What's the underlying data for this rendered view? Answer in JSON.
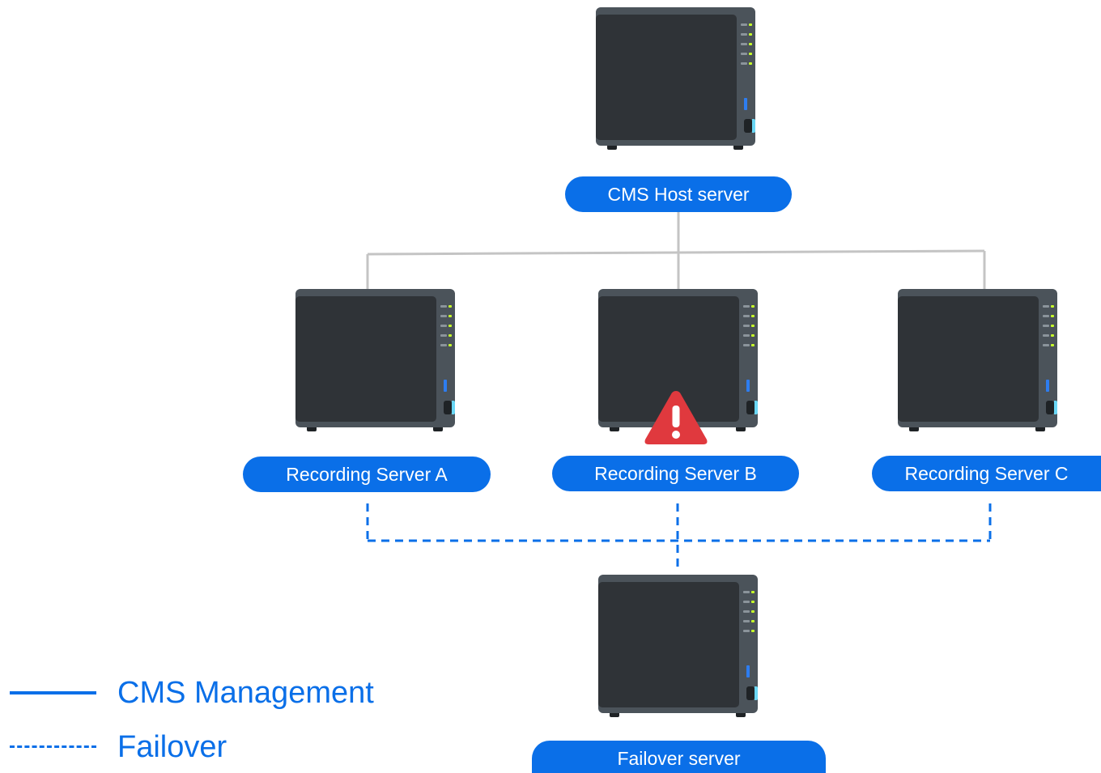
{
  "nodes": {
    "cms_host": {
      "label": "CMS Host server"
    },
    "recording_a": {
      "label": "Recording Server A"
    },
    "recording_b": {
      "label": "Recording Server B",
      "status": "warning"
    },
    "recording_c": {
      "label": "Recording Server C"
    },
    "failover": {
      "label": "Failover server"
    }
  },
  "legend": {
    "management": {
      "label": "CMS Management",
      "style": "solid"
    },
    "failover": {
      "label": "Failover",
      "style": "dashed"
    }
  },
  "colors": {
    "accent": "#0a6fe8",
    "management_connector": "#c4c4c4",
    "warning": "#e0393e",
    "device_body": "#2f3337",
    "device_shell": "#4b535a",
    "led_active": "#c6ff2a"
  },
  "icons": {
    "device": "nas-device-icon",
    "warning": "warning-triangle-icon"
  }
}
